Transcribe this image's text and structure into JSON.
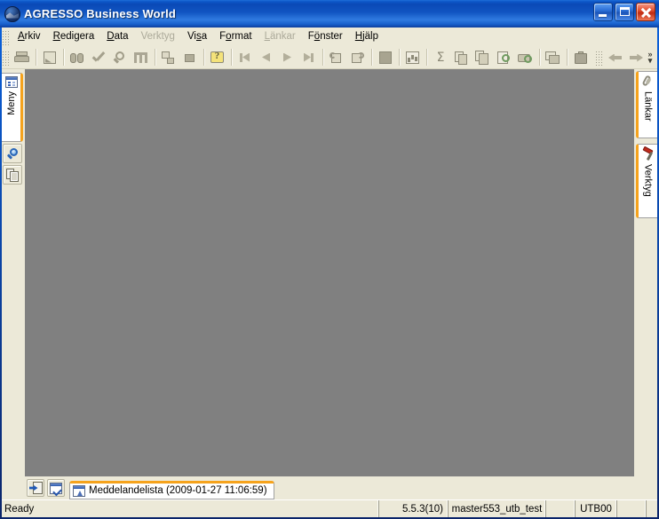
{
  "window": {
    "title": "AGRESSO Business World",
    "app_icon": "globe-icon",
    "buttons": {
      "minimize": "minimize-button",
      "maximize": "maximize-button",
      "close": "close-button"
    },
    "title_bar_color": "#0a49b6",
    "accent_color": "#f6a31c",
    "face_color": "#ece9d8",
    "mdi_color": "#808080"
  },
  "menu": {
    "items": [
      {
        "label": "Arkiv",
        "mnemonic": "A",
        "disabled": false
      },
      {
        "label": "Redigera",
        "mnemonic": "R",
        "disabled": false
      },
      {
        "label": "Data",
        "mnemonic": "D",
        "disabled": false
      },
      {
        "label": "Verktyg",
        "mnemonic": "g",
        "disabled": true
      },
      {
        "label": "Visa",
        "mnemonic": "s",
        "disabled": false
      },
      {
        "label": "Format",
        "mnemonic": "o",
        "disabled": false
      },
      {
        "label": "Länkar",
        "mnemonic": "L",
        "disabled": true
      },
      {
        "label": "Fönster",
        "mnemonic": "ö",
        "disabled": false
      },
      {
        "label": "Hjälp",
        "mnemonic": "H",
        "disabled": false
      }
    ]
  },
  "toolbar": {
    "overflow_label": "»",
    "overflow_arrow": "▾",
    "groups": [
      {
        "items": [
          {
            "name": "print-button",
            "icon": "printer-icon",
            "disabled": true
          }
        ]
      },
      {
        "items": [
          {
            "name": "export-button",
            "icon": "export-page-icon",
            "disabled": true
          }
        ]
      },
      {
        "items": [
          {
            "name": "find-button",
            "icon": "binoculars-icon",
            "disabled": true
          },
          {
            "name": "validate-button",
            "icon": "check-icon",
            "disabled": true
          },
          {
            "name": "search-button",
            "icon": "magnifier-icon",
            "disabled": true
          },
          {
            "name": "filter-button",
            "icon": "filter-icon",
            "disabled": true
          }
        ]
      },
      {
        "items": [
          {
            "name": "relations-button",
            "icon": "hierarchy-icon",
            "disabled": true
          },
          {
            "name": "stop-button",
            "icon": "stop-square-icon",
            "disabled": true
          }
        ]
      },
      {
        "items": [
          {
            "name": "help-button",
            "icon": "help-question-icon",
            "disabled": false
          }
        ]
      },
      {
        "items": [
          {
            "name": "first-record-button",
            "icon": "first-arrow-icon",
            "disabled": true
          },
          {
            "name": "previous-record-button",
            "icon": "previous-arrow-icon",
            "disabled": true
          },
          {
            "name": "next-record-button",
            "icon": "next-arrow-icon",
            "disabled": true
          },
          {
            "name": "last-record-button",
            "icon": "last-arrow-icon",
            "disabled": true
          }
        ]
      },
      {
        "items": [
          {
            "name": "undo-button",
            "icon": "undo-icon",
            "disabled": true
          },
          {
            "name": "redo-button",
            "icon": "redo-icon",
            "disabled": true
          }
        ]
      },
      {
        "items": [
          {
            "name": "block-button",
            "icon": "filled-square-icon",
            "disabled": true
          }
        ]
      },
      {
        "items": [
          {
            "name": "chart-button",
            "icon": "bar-chart-icon",
            "disabled": true
          }
        ]
      },
      {
        "items": [
          {
            "name": "sum-button",
            "icon": "sigma-icon",
            "disabled": true,
            "glyph": "Σ"
          },
          {
            "name": "duplicate-button",
            "icon": "copy-stack-icon",
            "disabled": true
          },
          {
            "name": "copy-button",
            "icon": "copy-pages-icon",
            "disabled": true
          },
          {
            "name": "print-preview-button",
            "icon": "page-preview-icon",
            "disabled": true
          },
          {
            "name": "printer-preview-button",
            "icon": "printer-preview-icon",
            "disabled": true
          }
        ]
      },
      {
        "items": [
          {
            "name": "cascade-windows-button",
            "icon": "cascade-windows-icon",
            "disabled": true
          }
        ]
      },
      {
        "items": [
          {
            "name": "briefcase-button",
            "icon": "briefcase-icon",
            "disabled": true
          }
        ]
      },
      {
        "items": [
          {
            "name": "back-button",
            "icon": "back-arrow-icon",
            "disabled": true
          },
          {
            "name": "forward-button",
            "icon": "forward-arrow-icon",
            "disabled": true
          }
        ]
      },
      {
        "items": [
          {
            "name": "record-button",
            "icon": "circle-dot-icon",
            "disabled": true
          }
        ]
      },
      {
        "items": [
          {
            "name": "new-document-button",
            "icon": "document-icon",
            "disabled": true
          }
        ]
      }
    ]
  },
  "left_dock": {
    "tabs": [
      {
        "label": "Meny",
        "icon": "menu-panel-icon",
        "active": true
      }
    ],
    "buttons": [
      {
        "name": "search-panel-button",
        "icon": "magnifier-blue-icon"
      },
      {
        "name": "copies-panel-button",
        "icon": "copy-pages-blue-icon"
      }
    ]
  },
  "right_dock": {
    "tabs": [
      {
        "label": "Länkar",
        "icon": "paperclip-icon",
        "active": false
      },
      {
        "label": "Verktyg",
        "icon": "hammer-icon",
        "active": false
      }
    ]
  },
  "tabstrip": {
    "buttons": [
      {
        "name": "open-message-button",
        "icon": "inbox-arrow-icon"
      },
      {
        "name": "confirm-messages-button",
        "icon": "checkbox-window-icon"
      }
    ],
    "tabs": [
      {
        "name": "tab-meddelandelista",
        "label": "Meddelandelista (2009-01-27 11:06:59)",
        "icon": "alert-window-icon",
        "active": true
      }
    ]
  },
  "status_bar": {
    "message": "Ready",
    "version": "5.5.3(10)",
    "database": "master553_utb_test",
    "blank_1": "",
    "client": "UTB00",
    "blank_2": "",
    "blank_3": "",
    "blank_4": "",
    "blank_5": "",
    "resize_grip": "resize-grip"
  }
}
